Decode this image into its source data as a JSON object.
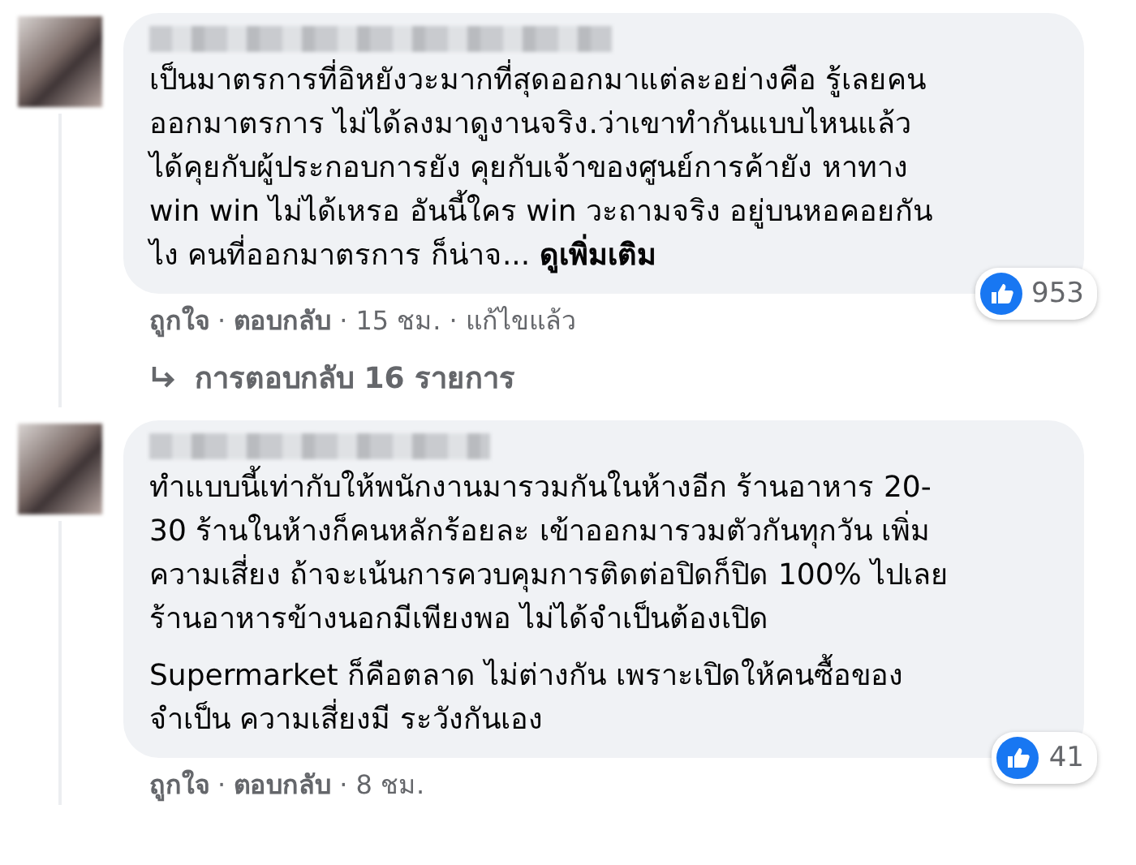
{
  "separator": "·",
  "comments": [
    {
      "paragraphs": [
        "เป็นมาตรการที่อิหยังวะมากที่สุดออกมาแต่ละอย่างคือ รู้เลยคน\nออกมาตรการ ไม่ได้ลงมาดูงานจริง.ว่าเขาทำกันแบบไหนแล้ว\nได้คุยกับผู้ประกอบการยัง คุยกับเจ้าของศูนย์การค้ายัง หาทาง\nwin win ไม่ได้เหรอ อันนี้ใคร win วะถามจริง อยู่บนหอคอยกัน\nไง คนที่ออกมาตรการ ก็น่าจ..."
      ],
      "see_more": "ดูเพิ่มเติม",
      "reactions": "953",
      "footer": [
        {
          "text": "ถูกใจ",
          "kind": "link"
        },
        {
          "text": "ตอบกลับ",
          "kind": "link"
        },
        {
          "text": "15 ชม.",
          "kind": "text"
        },
        {
          "text": "แก้ไขแล้ว",
          "kind": "text"
        }
      ],
      "replies_link": "การตอบกลับ 16 รายการ"
    },
    {
      "paragraphs": [
        "ทำแบบนี้เท่ากับให้พนักงานมารวมกันในห้างอีก ร้านอาหาร 20-\n30 ร้านในห้างก็คนหลักร้อยละ เข้าออกมารวมตัวกันทุกวัน เพิ่ม\nความเสี่ยง ถ้าจะเน้นการควบคุมการติดต่อปิดก็ปิด 100% ไปเลย\nร้านอาหารข้างนอกมีเพียงพอ ไม่ได้จำเป็นต้องเปิด",
        "Supermarket ก็คือตลาด ไม่ต่างกัน เพราะเปิดให้คนซื้อของ\nจำเป็น ความเสี่ยงมี ระวังกันเอง"
      ],
      "reactions": "41",
      "footer": [
        {
          "text": "ถูกใจ",
          "kind": "link"
        },
        {
          "text": "ตอบกลับ",
          "kind": "link"
        },
        {
          "text": "8 ชม.",
          "kind": "text"
        }
      ]
    }
  ]
}
